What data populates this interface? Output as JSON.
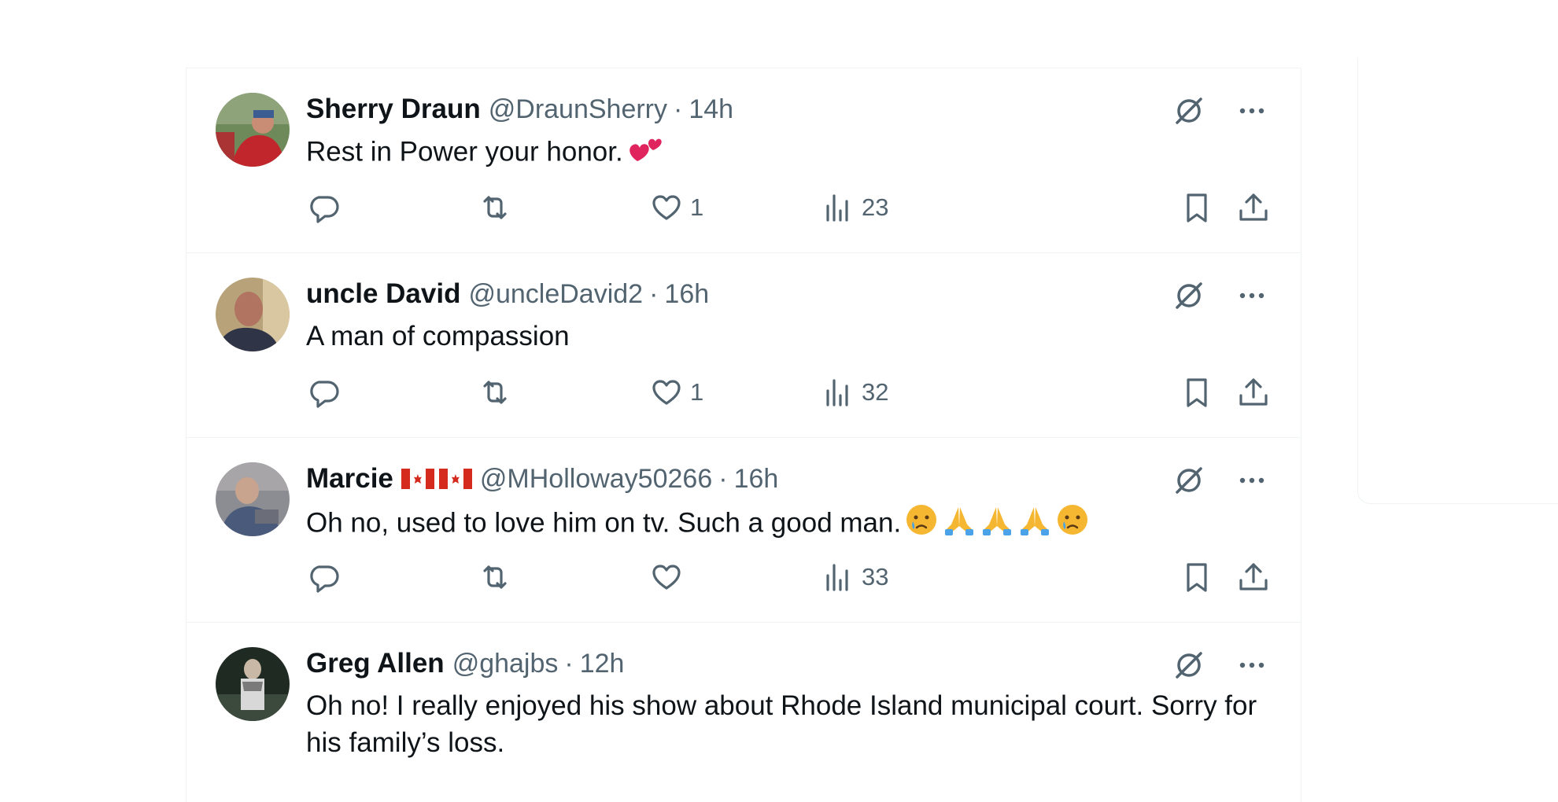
{
  "replies": [
    {
      "name": "Sherry Draun",
      "handle": "@DraunSherry",
      "dot": "·",
      "time": "14h",
      "text": "Rest in Power  your honor.",
      "likes": "1",
      "views": "23"
    },
    {
      "name": "uncle David",
      "handle": "@uncleDavid2",
      "dot": "·",
      "time": "16h",
      "text": "A man of compassion",
      "likes": "1",
      "views": "32"
    },
    {
      "name": "Marcie",
      "handle": "@MHolloway50266",
      "dot": "·",
      "time": "16h",
      "text": "Oh no,  used to love him on tv.  Such a good man.",
      "likes": "",
      "views": "33"
    },
    {
      "name": "Greg Allen",
      "handle": "@ghajbs",
      "dot": "·",
      "time": "12h",
      "text": "Oh no!  I really enjoyed his show about Rhode Island municipal court.  Sorry for his family’s loss.",
      "likes": "",
      "views": ""
    }
  ],
  "icons": {
    "reply": "reply-icon",
    "repost": "repost-icon",
    "like": "heart-icon",
    "views": "analytics-icon",
    "bookmark": "bookmark-icon",
    "share": "share-icon",
    "grok": "grok-icon",
    "more": "more-icon",
    "flag": "canada-flag-icon"
  },
  "colors": {
    "text": "#0f1419",
    "secondary": "#536471",
    "border": "#eff3f4"
  }
}
